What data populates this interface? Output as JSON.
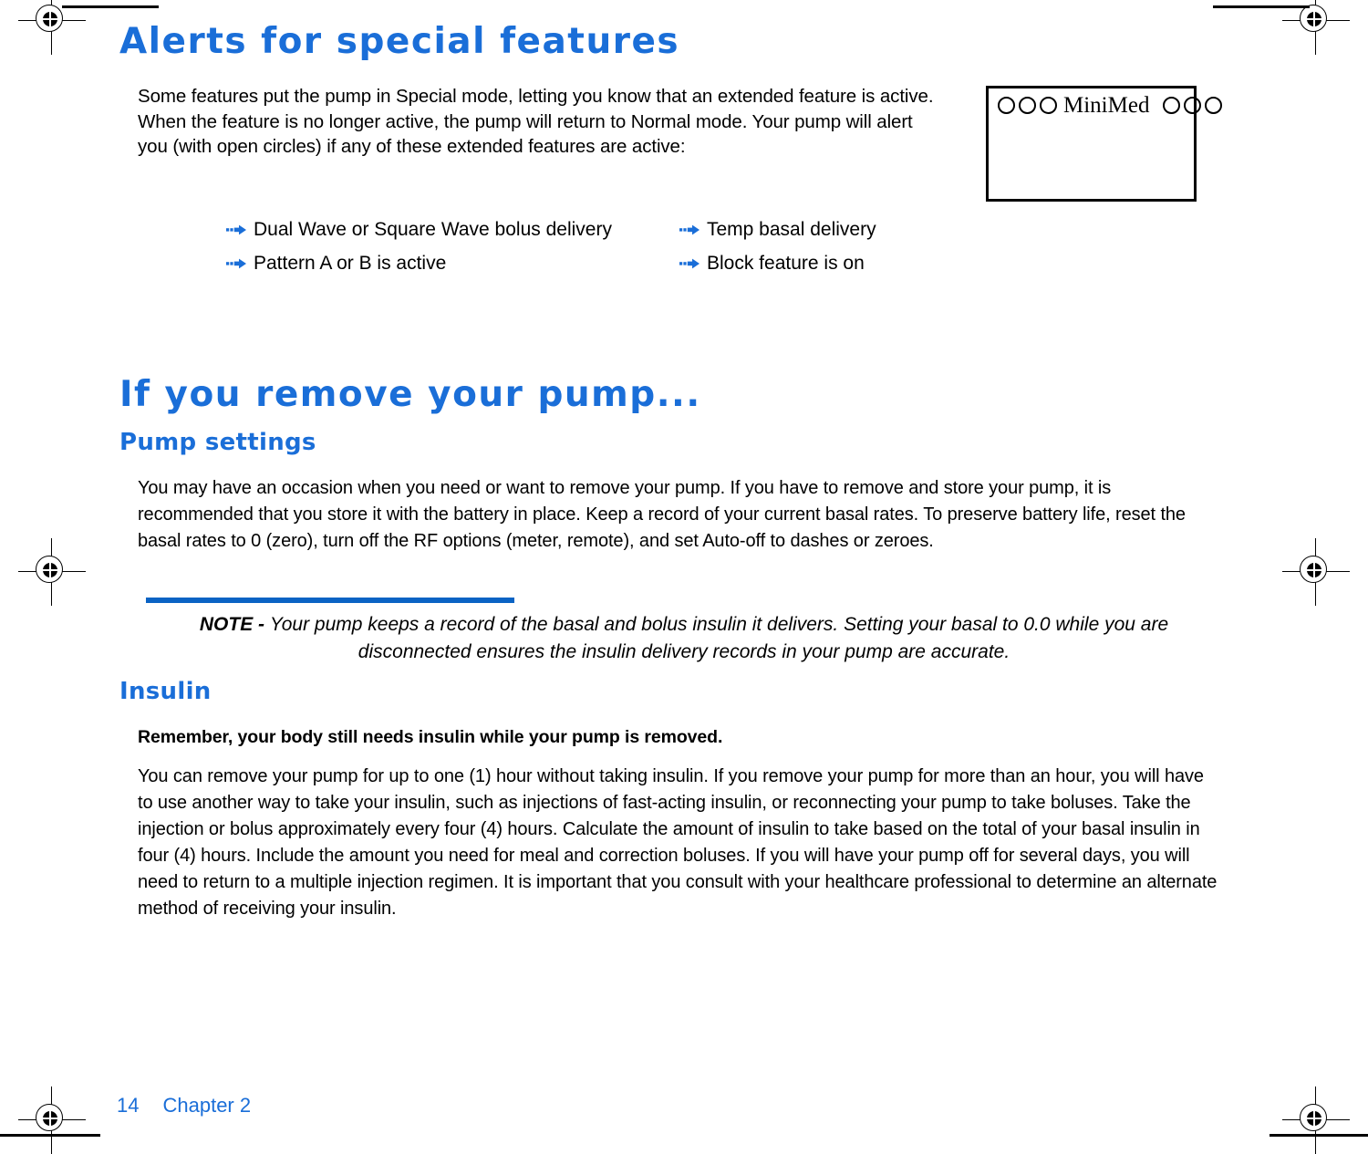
{
  "document": {
    "section_alerts": {
      "heading": "Alerts for special features",
      "intro": "Some features put the pump in Special mode, letting you know that an extended feature is active. When the feature is no longer active, the pump will return to Normal mode. Your pump will alert you (with open circles) if any of these extended features are active:",
      "bullets_left": [
        "Dual Wave or Square Wave bolus delivery",
        "Pattern A or B is active"
      ],
      "bullets_right": [
        "Temp basal delivery",
        "Block feature is on"
      ]
    },
    "pump_display": {
      "brand": "MiniMed",
      "left_circles": 3,
      "right_circles": 3
    },
    "section_remove": {
      "heading": "If you remove your pump...",
      "subheading_pump_settings": "Pump settings",
      "pump_settings_body": "You may have an occasion when you need or want to remove your pump. If you have to remove and store your pump, it is recommended that you store it with the battery in place. Keep a record of your current basal rates. To preserve battery life, reset the basal rates to 0 (zero), turn off the RF options (meter, remote), and set Auto-off to dashes or zeroes.",
      "note": {
        "label": "NOTE - ",
        "text": "Your pump keeps a record of the basal and bolus insulin it delivers. Setting your basal to 0.0 while you are disconnected ensures the insulin delivery records in your pump are accurate."
      },
      "subheading_insulin": "Insulin",
      "insulin_bold": "Remember, your body still needs insulin while your pump is removed.",
      "insulin_body": "You can remove your pump for up to one (1) hour without taking insulin. If you remove your pump for more than an hour, you will have to use another way to take your insulin, such as injections of fast-acting insulin, or reconnecting your pump to take boluses. Take the injection or bolus approximately every four (4) hours. Calculate the amount of insulin to take based on the total of your basal insulin in four (4) hours. Include the amount you need for meal and correction boluses. If you will have your pump off for several days, you will need to return to a multiple injection regimen. It is important that you consult with your healthcare professional to determine an alternate method of receiving your insulin."
    },
    "footer": {
      "page_number": "14",
      "chapter": "Chapter 2"
    },
    "colors": {
      "heading_blue": "#1a6ed8",
      "rule_blue": "#0a63c4",
      "body_black": "#000000"
    }
  }
}
